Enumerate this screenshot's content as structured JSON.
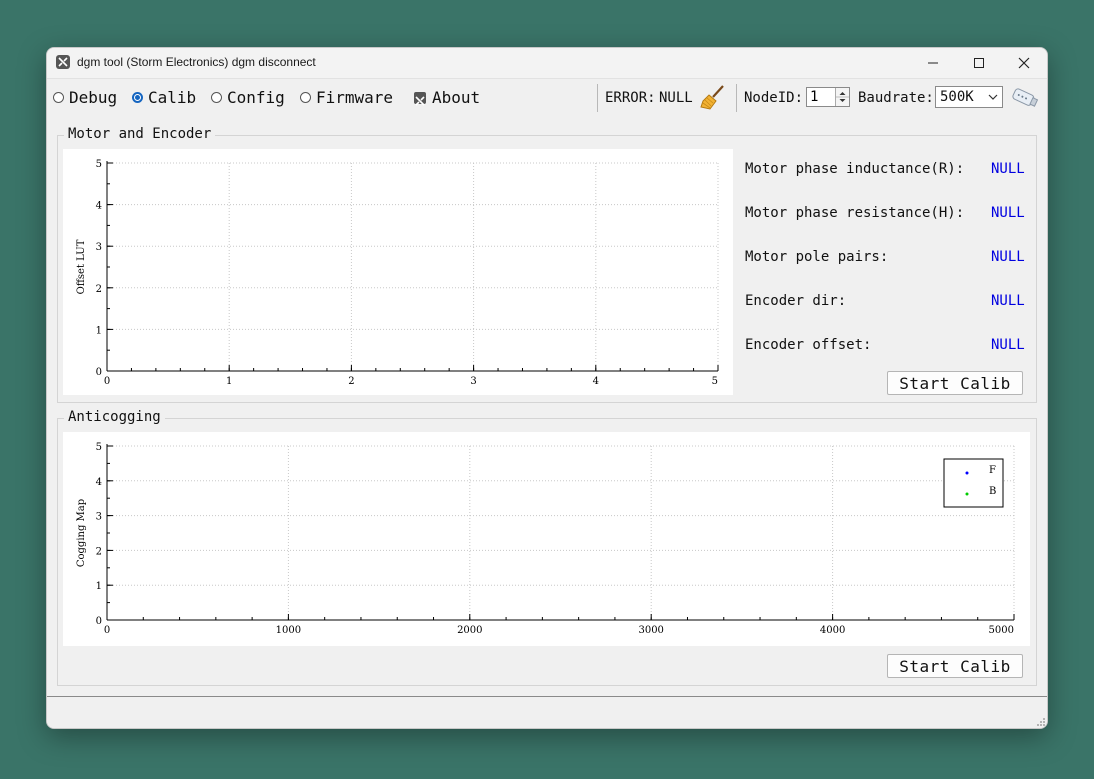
{
  "window": {
    "title": "dgm tool (Storm Electronics)  dgm disconnect",
    "icon": "tool-icon",
    "controls": [
      "minimize-icon",
      "maximize-icon",
      "close-icon"
    ]
  },
  "toolbar": {
    "modes": [
      {
        "label": "Debug",
        "checked": false
      },
      {
        "label": "Calib",
        "checked": true
      },
      {
        "label": "Config",
        "checked": false
      },
      {
        "label": "Firmware",
        "checked": false
      }
    ],
    "about_label": "About",
    "error_label": "ERROR:",
    "error_value": "NULL",
    "clear_icon": "broom-icon",
    "nodeid_label": "NodeID:",
    "nodeid_value": "1",
    "baudrate_label": "Baudrate:",
    "baudrate_value": "500K",
    "connect_icon": "usb-adapter-icon"
  },
  "motor_encoder": {
    "title": "Motor and Encoder",
    "fields": [
      {
        "label": "Motor phase inductance(R):",
        "value": "NULL"
      },
      {
        "label": "Motor phase resistance(H):",
        "value": "NULL"
      },
      {
        "label": "Motor pole pairs:",
        "value": "NULL"
      },
      {
        "label": "Encoder dir:",
        "value": "NULL"
      },
      {
        "label": "Encoder offset:",
        "value": "NULL"
      }
    ],
    "button_label": "Start Calib"
  },
  "anticogging": {
    "title": "Anticogging",
    "button_label": "Start Calib"
  },
  "colors": {
    "value_text": "#0000e0",
    "legend_f": "#0000ff",
    "legend_b": "#00cc00",
    "radio_checked": "#1565c0"
  },
  "chart_data": [
    {
      "type": "scatter",
      "title": "",
      "xlabel": "",
      "ylabel": "Offset LUT",
      "xlim": [
        0,
        5
      ],
      "ylim": [
        0,
        5
      ],
      "xticks": [
        "0",
        "1",
        "2",
        "3",
        "4",
        "5"
      ],
      "yticks": [
        "0",
        "1",
        "2",
        "3",
        "4",
        "5"
      ],
      "grid": true,
      "series": []
    },
    {
      "type": "scatter",
      "title": "",
      "xlabel": "",
      "ylabel": "Cogging Map",
      "xlim": [
        0,
        5000
      ],
      "ylim": [
        0,
        5
      ],
      "xticks": [
        "0",
        "1000",
        "2000",
        "3000",
        "4000",
        "5000"
      ],
      "yticks": [
        "0",
        "1",
        "2",
        "3",
        "4",
        "5"
      ],
      "grid": true,
      "legend": "top-right",
      "series": [
        {
          "name": "F",
          "values": []
        },
        {
          "name": "B",
          "values": []
        }
      ]
    }
  ]
}
